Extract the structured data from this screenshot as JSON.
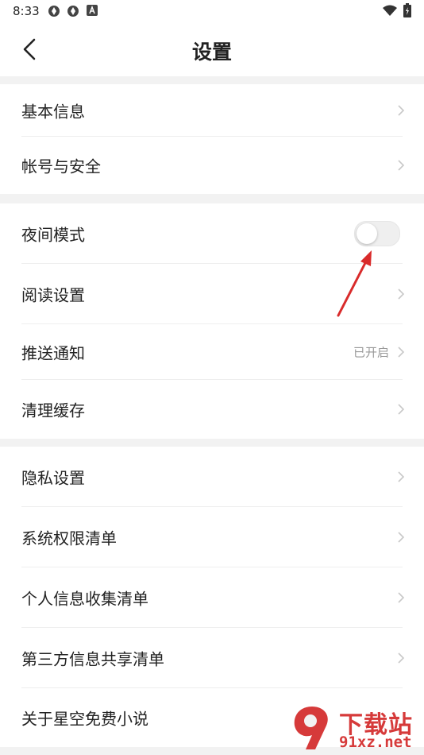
{
  "status_bar": {
    "time": "8:33"
  },
  "header": {
    "title": "设置"
  },
  "groups": [
    {
      "items": [
        {
          "label": "基本信息"
        },
        {
          "label": "帐号与安全"
        }
      ]
    },
    {
      "items": [
        {
          "label": "夜间模式",
          "toggle": {
            "on": false
          }
        },
        {
          "label": "阅读设置"
        },
        {
          "label": "推送通知",
          "value": "已开启"
        },
        {
          "label": "清理缓存"
        }
      ]
    },
    {
      "items": [
        {
          "label": "隐私设置"
        },
        {
          "label": "系统权限清单"
        },
        {
          "label": "个人信息收集清单"
        },
        {
          "label": "第三方信息共享清单"
        },
        {
          "label": "关于星空免费小说"
        }
      ]
    }
  ],
  "watermark": {
    "main_text": "下载站",
    "sub_text": "91xz.net"
  },
  "colors": {
    "watermark_red": "#d63a3a",
    "arrow_red": "#d92b2b",
    "chevron_grey": "#c8c8c8"
  }
}
